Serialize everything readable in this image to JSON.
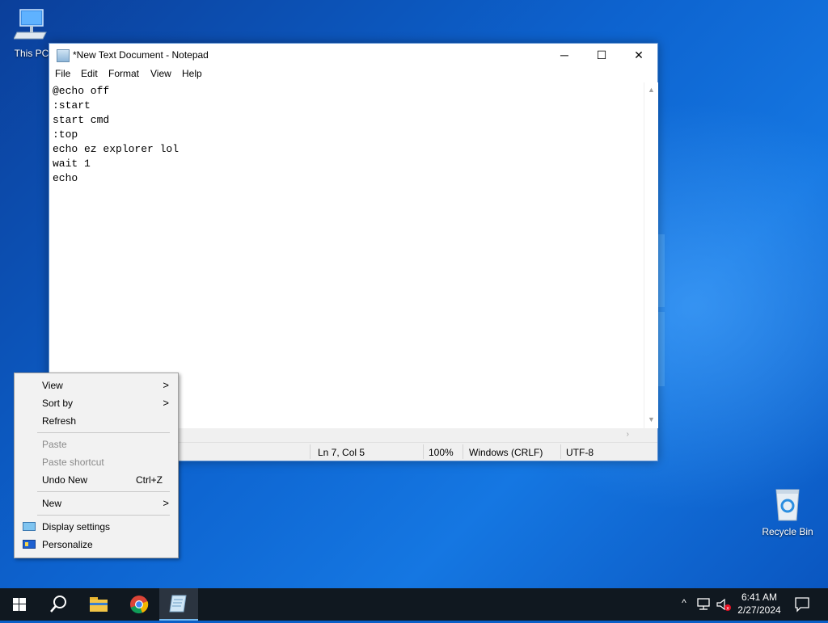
{
  "desktop": {
    "icons": [
      {
        "label": "This PC"
      },
      {
        "label": "Recycle Bin"
      }
    ]
  },
  "notepad": {
    "title": "*New Text Document - Notepad",
    "controls": {
      "minimize": "─",
      "maximize": "☐",
      "close": "✕"
    },
    "menu": [
      "File",
      "Edit",
      "Format",
      "View",
      "Help"
    ],
    "lines": [
      "@echo off",
      ":start",
      "start cmd",
      ":top",
      "echo ez explorer lol",
      "wait 1",
      "echo"
    ],
    "status": {
      "position": "Ln 7, Col 5",
      "zoom": "100%",
      "line_ending": "Windows (CRLF)",
      "encoding": "UTF-8"
    }
  },
  "context_menu": {
    "view": "View",
    "sort_by": "Sort by",
    "refresh": "Refresh",
    "paste": "Paste",
    "paste_shortcut": "Paste shortcut",
    "undo_new": "Undo New",
    "undo_shortcut": "Ctrl+Z",
    "new": "New",
    "display_settings": "Display settings",
    "personalize": "Personalize"
  },
  "taskbar": {
    "time": "6:41 AM",
    "date": "2/27/2024"
  },
  "colors": {
    "accent": "#0078d7",
    "taskbar": "#101820"
  }
}
